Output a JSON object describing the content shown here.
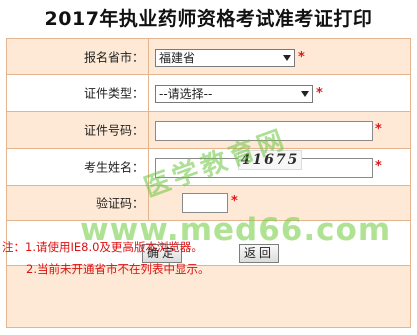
{
  "page": {
    "title": "2017年执业药师资格考试准考证打印"
  },
  "form": {
    "province": {
      "label": "报名省市：",
      "value": "福建省"
    },
    "id_type": {
      "label": "证件类型：",
      "value": "--请选择--"
    },
    "id_number": {
      "label": "证件号码：",
      "value": ""
    },
    "name": {
      "label": "考生姓名：",
      "value": ""
    },
    "captcha": {
      "label": "验证码：",
      "value": "",
      "image_text": "41675"
    },
    "required_mark": "*"
  },
  "buttons": {
    "confirm": "确定",
    "back": "返回"
  },
  "notes": [
    "注：1.请使用IE8.0及更高版本浏览器。",
    "2.当前未开通省市不在列表中显示。"
  ],
  "watermark": {
    "line1": "医学教育网",
    "line2": "www.med66.com"
  },
  "colors": {
    "row_tint": "#fde9d6",
    "border": "#e3b48d",
    "required": "#e0181a",
    "watermark": "#6cc542"
  }
}
